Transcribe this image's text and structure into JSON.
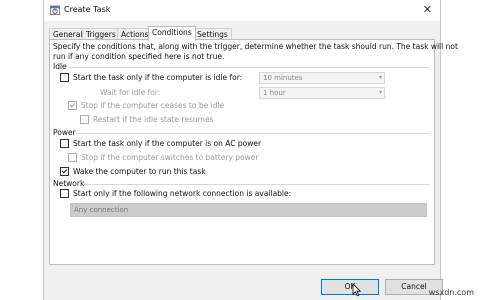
{
  "window": {
    "title": "Create Task",
    "close_glyph": "✕"
  },
  "tabs": [
    "General",
    "Triggers",
    "Actions",
    "Conditions",
    "Settings"
  ],
  "description_line1": "Specify the conditions that, along with the trigger, determine whether the task should run.  The task will not",
  "description_line2": "run  if any condition specified here is not true.",
  "idle": {
    "heading": "Idle",
    "start_if_idle": {
      "label": "Start the task only if the computer is idle for:",
      "checked": false
    },
    "idle_duration": {
      "value": "10 minutes"
    },
    "wait_label": "Wait for idle for:",
    "wait_duration": {
      "value": "1 hour"
    },
    "stop_if_not_idle": {
      "label": "Stop if the computer ceases to be idle",
      "checked": true
    },
    "restart_if_idle": {
      "label": "Restart if the idle state resumes",
      "checked": false
    }
  },
  "power": {
    "heading": "Power",
    "ac_power": {
      "label": "Start the task only if the computer is on AC power",
      "checked": false
    },
    "battery": {
      "label": "Stop if the computer switches to battery power",
      "checked": false
    },
    "wake": {
      "label": "Wake the computer to run this task",
      "checked": true
    }
  },
  "network": {
    "heading": "Network",
    "start_if_network": {
      "label": "Start only if the following network connection is available:",
      "checked": false
    },
    "connection": {
      "value": "Any connection"
    }
  },
  "buttons": {
    "ok": "OK",
    "cancel": "Cancel"
  },
  "watermark": "wsxdn.com"
}
